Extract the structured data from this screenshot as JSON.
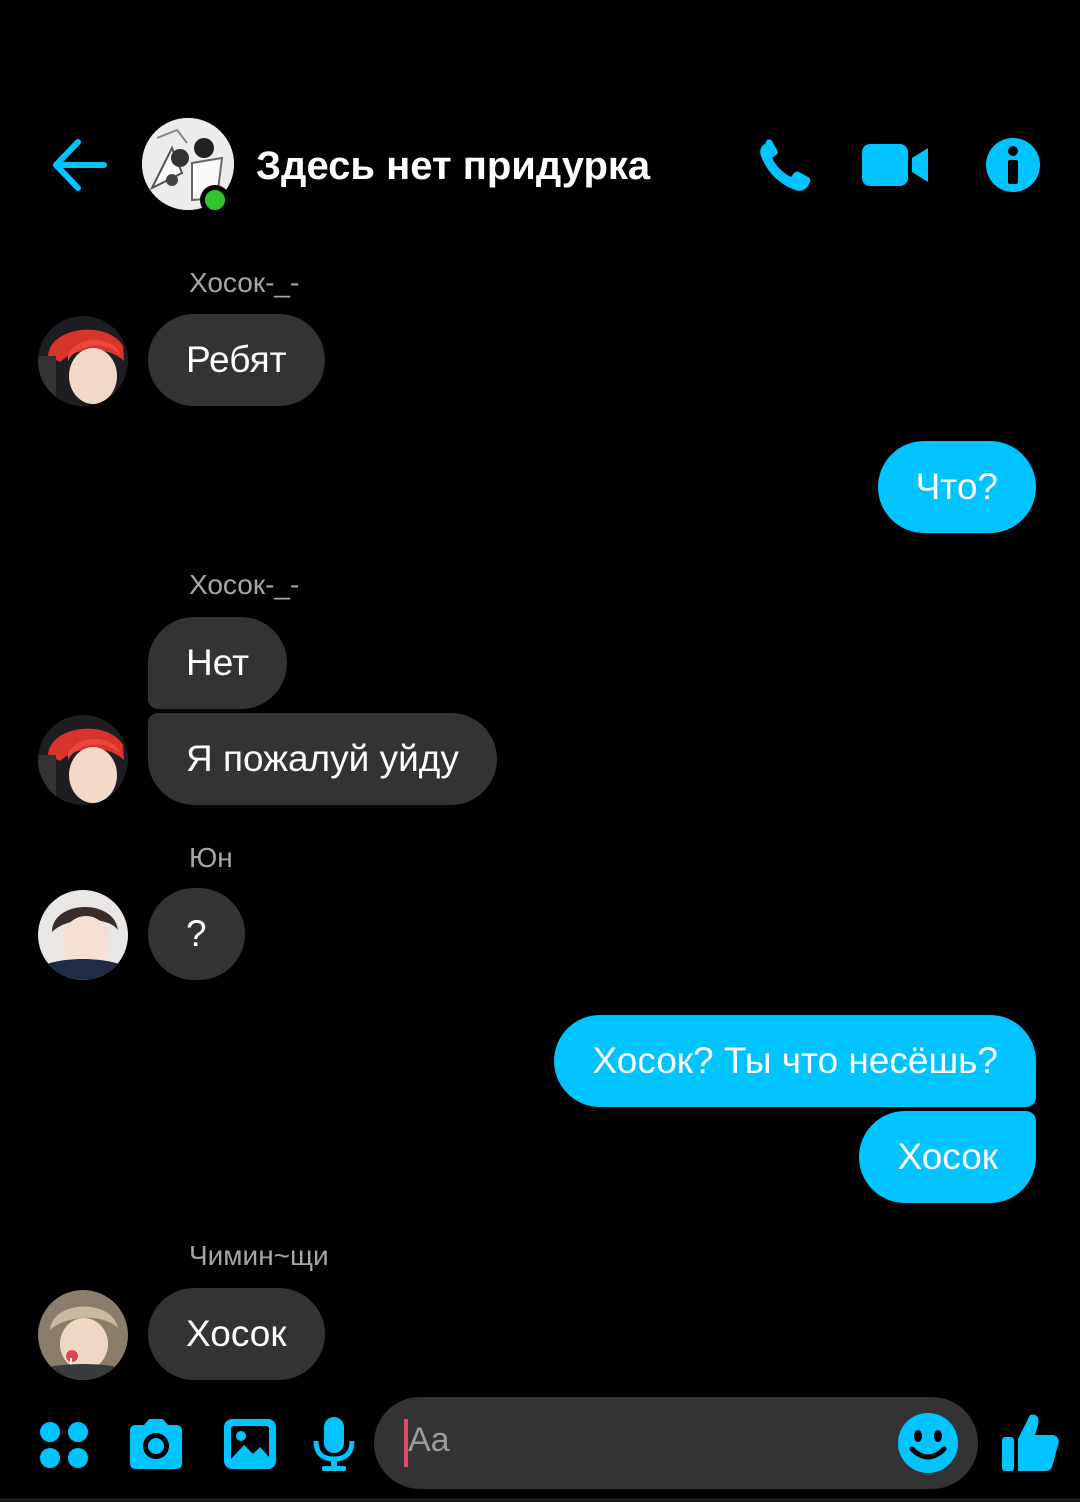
{
  "header": {
    "title": "Здесь нет придурка",
    "back_icon": "arrow-left-icon",
    "call_icon": "phone-icon",
    "video_icon": "video-camera-icon",
    "info_icon": "info-icon",
    "online_status_color": "#31c62f"
  },
  "messages": [
    {
      "sender": "Хосок-_-",
      "text": "Ребят",
      "direction": "incoming"
    },
    {
      "text": "Что?",
      "direction": "outgoing"
    },
    {
      "sender": "Хосок-_-",
      "text": "Нет",
      "direction": "incoming"
    },
    {
      "text": "Я пожалуй уйду",
      "direction": "incoming"
    },
    {
      "sender": "Юн",
      "text": "?",
      "direction": "incoming"
    },
    {
      "text": "Хосок? Ты что несёшь?",
      "direction": "outgoing"
    },
    {
      "text": "Хосок",
      "direction": "outgoing"
    },
    {
      "sender": "Чимин~щи",
      "text": "Хосок",
      "direction": "incoming"
    }
  ],
  "composer": {
    "placeholder": "Aa",
    "icons": [
      "apps-grid-icon",
      "camera-icon",
      "gallery-icon",
      "microphone-icon",
      "emoji-icon",
      "thumbs-up-icon"
    ]
  },
  "colors": {
    "accent": "#00c3ff",
    "background": "#000000",
    "incoming_bubble": "#333335",
    "outgoing_bubble": "#00c3ff",
    "sender_name": "#a6a6a6"
  }
}
